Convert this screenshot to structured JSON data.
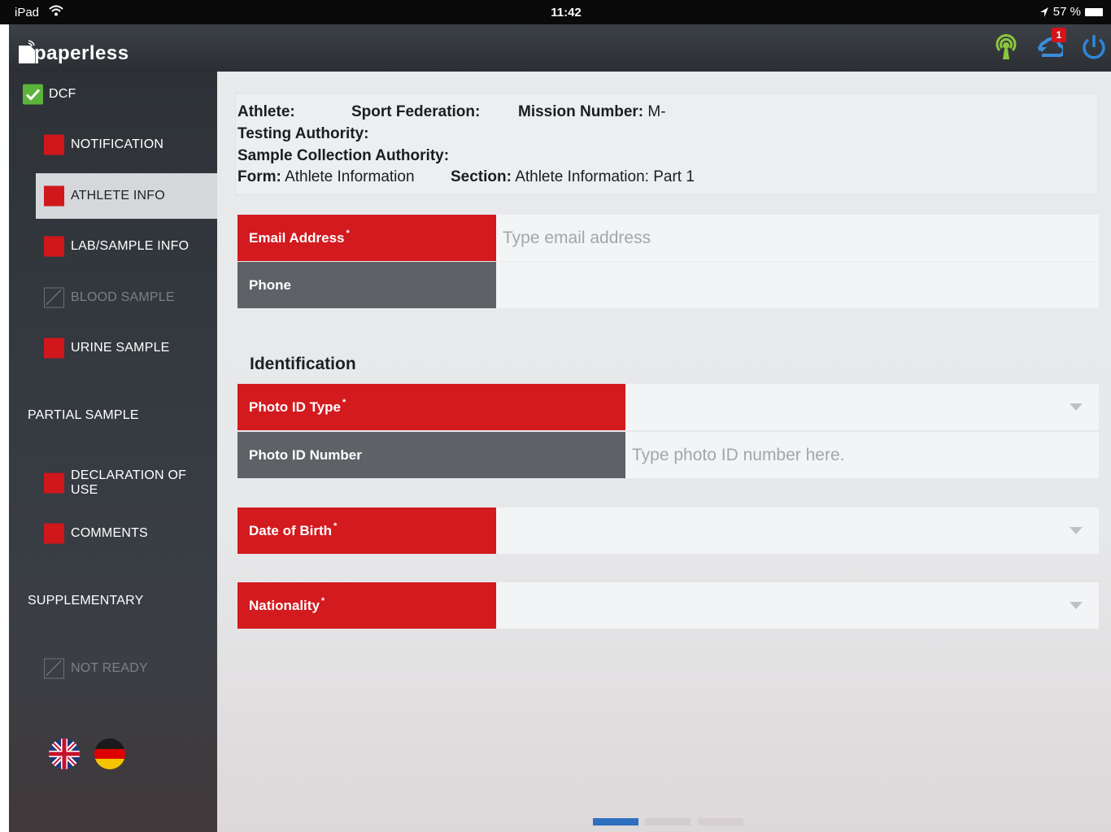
{
  "statusbar": {
    "device": "iPad",
    "time": "11:42",
    "battery": "57 %"
  },
  "app": {
    "logo_text": "paperless",
    "notification_count": "1"
  },
  "sidebar": {
    "dcf": "DCF",
    "items": [
      {
        "label": "NOTIFICATION"
      },
      {
        "label": "ATHLETE INFO"
      },
      {
        "label": "LAB/SAMPLE INFO"
      },
      {
        "label": "BLOOD SAMPLE"
      },
      {
        "label": "URINE SAMPLE"
      }
    ],
    "partial_title": "PARTIAL SAMPLE",
    "partial_items": [
      {
        "label": "DECLARATION OF USE"
      },
      {
        "label": "COMMENTS"
      }
    ],
    "supplementary_title": "SUPPLEMENTARY",
    "supplementary_items": [
      {
        "label": "NOT READY"
      }
    ]
  },
  "info": {
    "athlete_label": "Athlete:",
    "federation_label": "Sport Federation:",
    "mission_label": "Mission Number:",
    "mission_value": "M-",
    "testing_label": "Testing Authority:",
    "sample_label": "Sample Collection Authority:",
    "form_label": "Form:",
    "form_value": "Athlete Information",
    "section_label": "Section:",
    "section_value": "Athlete Information: Part 1"
  },
  "form": {
    "email_label": "Email Address",
    "email_placeholder": "Type email address",
    "phone_label": "Phone",
    "identification_heading": "Identification",
    "photo_type_label": "Photo ID Type",
    "photo_number_label": "Photo ID Number",
    "photo_number_placeholder": "Type photo ID number here.",
    "dob_label": "Date of Birth",
    "nationality_label": "Nationality",
    "required_mark": "*"
  },
  "colors": {
    "required": "#d31a1f",
    "optional": "#5e6166",
    "active_page": "#2f6fc0"
  }
}
